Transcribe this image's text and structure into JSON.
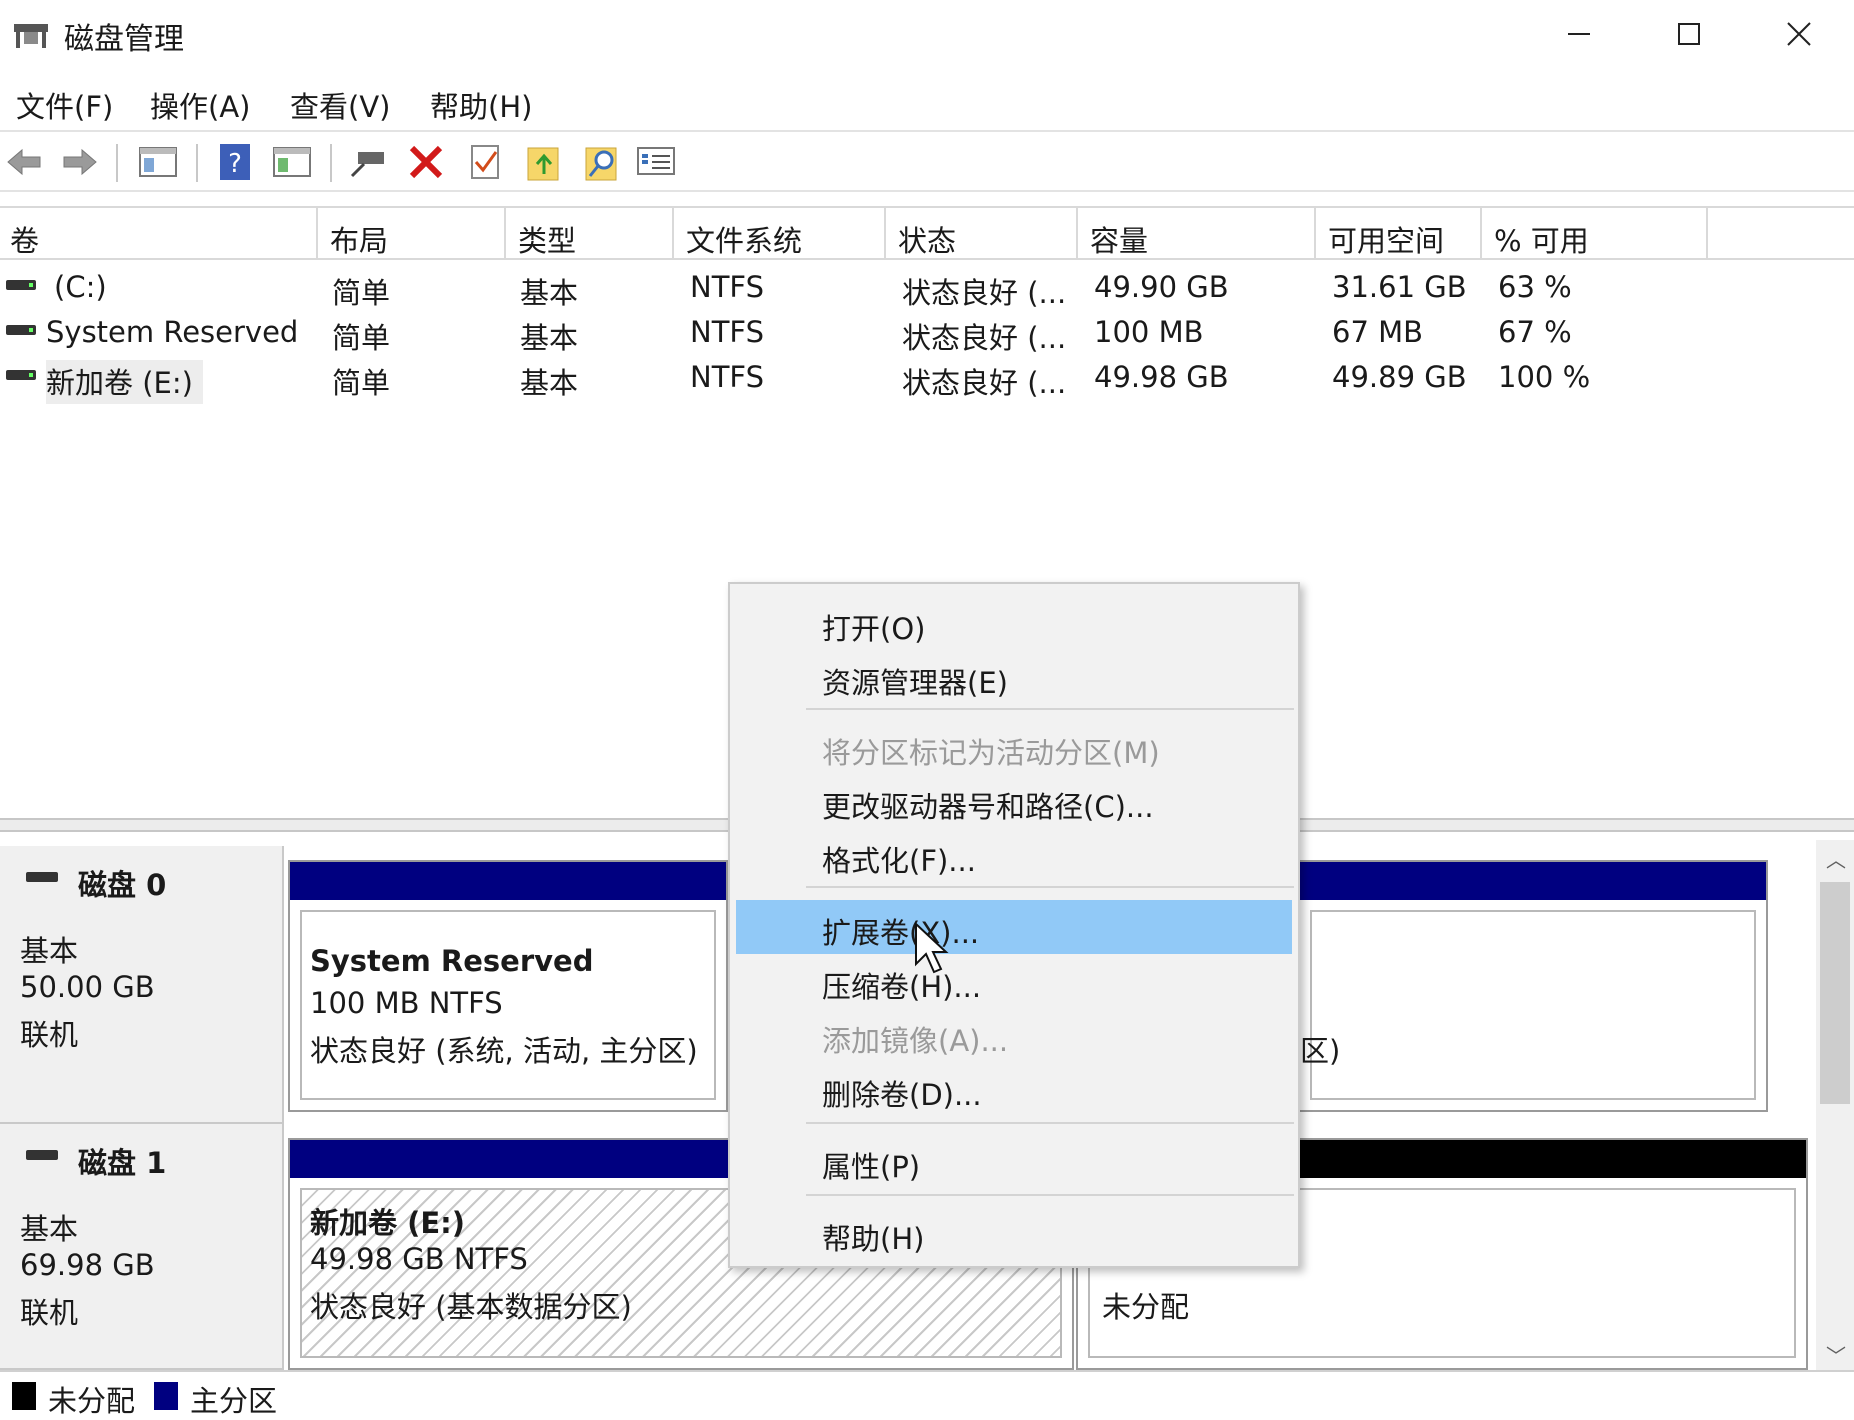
{
  "window": {
    "title": "磁盘管理",
    "minimize_icon": "minimize-icon",
    "maximize_icon": "maximize-icon",
    "close_icon": "close-icon"
  },
  "menu": {
    "file": "文件(F)",
    "action": "操作(A)",
    "view": "查看(V)",
    "help": "帮助(H)"
  },
  "toolbar": {
    "icons": [
      "back-arrow-icon",
      "forward-arrow-icon",
      "show-hide-console-tree-icon",
      "help-icon",
      "show-hide-action-pane-icon",
      "connect-icon",
      "delete-icon",
      "checkmark-icon",
      "folder-up-icon",
      "search-folder-icon",
      "properties-list-icon"
    ]
  },
  "columns": {
    "volume": "卷",
    "layout": "布局",
    "type": "类型",
    "filesystem": "文件系统",
    "status": "状态",
    "capacity": "容量",
    "free": "可用空间",
    "percent_free": "% 可用"
  },
  "volumes": [
    {
      "name": "(C:)",
      "layout": "简单",
      "type": "基本",
      "fs": "NTFS",
      "status": "状态良好 (...",
      "capacity": "49.90 GB",
      "free": "31.61 GB",
      "pct": "63 %"
    },
    {
      "name": "System Reserved",
      "layout": "简单",
      "type": "基本",
      "fs": "NTFS",
      "status": "状态良好 (...",
      "capacity": "100 MB",
      "free": "67 MB",
      "pct": "67 %"
    },
    {
      "name": "新加卷 (E:)",
      "layout": "简单",
      "type": "基本",
      "fs": "NTFS",
      "status": "状态良好 (...",
      "capacity": "49.98 GB",
      "free": "49.89 GB",
      "pct": "100 %"
    }
  ],
  "disks": [
    {
      "name": "磁盘 0",
      "type": "基本",
      "size": "50.00 GB",
      "state": "联机",
      "partitions": [
        {
          "title": "System Reserved",
          "detail": "100 MB NTFS",
          "status": "状态良好 (系统, 活动, 主分区)"
        },
        {
          "status_tail": "区)"
        }
      ]
    },
    {
      "name": "磁盘 1",
      "type": "基本",
      "size": "69.98 GB",
      "state": "联机",
      "partitions": [
        {
          "title": "新加卷  (E:)",
          "detail": "49.98 GB NTFS",
          "status": "状态良好 (基本数据分区)"
        },
        {
          "status": "未分配"
        }
      ]
    }
  ],
  "legend": {
    "unallocated": "未分配",
    "primary": "主分区",
    "unallocated_color": "#000000",
    "primary_color": "#000080"
  },
  "context_menu": {
    "items": [
      {
        "label": "打开(O)",
        "enabled": true
      },
      {
        "label": "资源管理器(E)",
        "enabled": true
      },
      {
        "label": "将分区标记为活动分区(M)",
        "enabled": false
      },
      {
        "label": "更改驱动器号和路径(C)...",
        "enabled": true
      },
      {
        "label": "格式化(F)...",
        "enabled": true
      },
      {
        "label": "扩展卷(X)...",
        "enabled": true,
        "highlighted": true
      },
      {
        "label": "压缩卷(H)...",
        "enabled": true
      },
      {
        "label": "添加镜像(A)...",
        "enabled": false
      },
      {
        "label": "删除卷(D)...",
        "enabled": true
      },
      {
        "label": "属性(P)",
        "enabled": true
      },
      {
        "label": "帮助(H)",
        "enabled": true
      }
    ]
  },
  "colors": {
    "primary_partition_bar": "#000080",
    "unallocated_bar": "#000000",
    "menu_highlight": "#91c9f7"
  }
}
